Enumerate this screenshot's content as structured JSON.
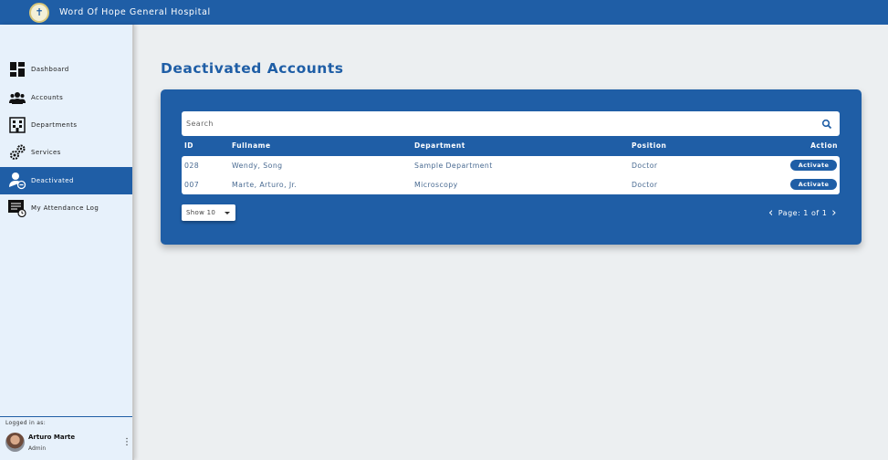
{
  "app": {
    "title": "Word Of Hope General Hospital",
    "logo_icon": "cross-seal-icon"
  },
  "sidebar": {
    "items": [
      {
        "label": "Dashboard",
        "icon": "dashboard-icon",
        "active": false
      },
      {
        "label": "Accounts",
        "icon": "users-icon",
        "active": false
      },
      {
        "label": "Departments",
        "icon": "building-icon",
        "active": false
      },
      {
        "label": "Services",
        "icon": "gears-icon",
        "active": false
      },
      {
        "label": "Deactivated",
        "icon": "user-minus-icon",
        "active": true
      },
      {
        "label": "My Attendance Log",
        "icon": "log-icon",
        "active": false
      }
    ],
    "user": {
      "logged_in_label": "Logged in as:",
      "name": "Arturo Marte",
      "role": "Admin"
    }
  },
  "main": {
    "title": "Deactivated Accounts",
    "search": {
      "placeholder": "Search",
      "value": ""
    },
    "table": {
      "headers": {
        "id": "ID",
        "name": "Fullname",
        "department": "Department",
        "position": "Position",
        "action": "Action"
      },
      "rows": [
        {
          "id": "028",
          "name": "Wendy, Song",
          "department": "Sample Department",
          "position": "Doctor",
          "action": "Activate"
        },
        {
          "id": "007",
          "name": "Marte, Arturo, Jr.",
          "department": "Microscopy",
          "position": "Doctor",
          "action": "Activate"
        }
      ]
    },
    "show_select": {
      "value": "Show 10"
    },
    "pagination": {
      "text": "Page: 1 of 1",
      "prev": "‹",
      "next": "›"
    }
  },
  "colors": {
    "brand": "#1f5ea6",
    "sidebar_bg": "#e7f1fb",
    "page_bg": "#eceff1"
  }
}
